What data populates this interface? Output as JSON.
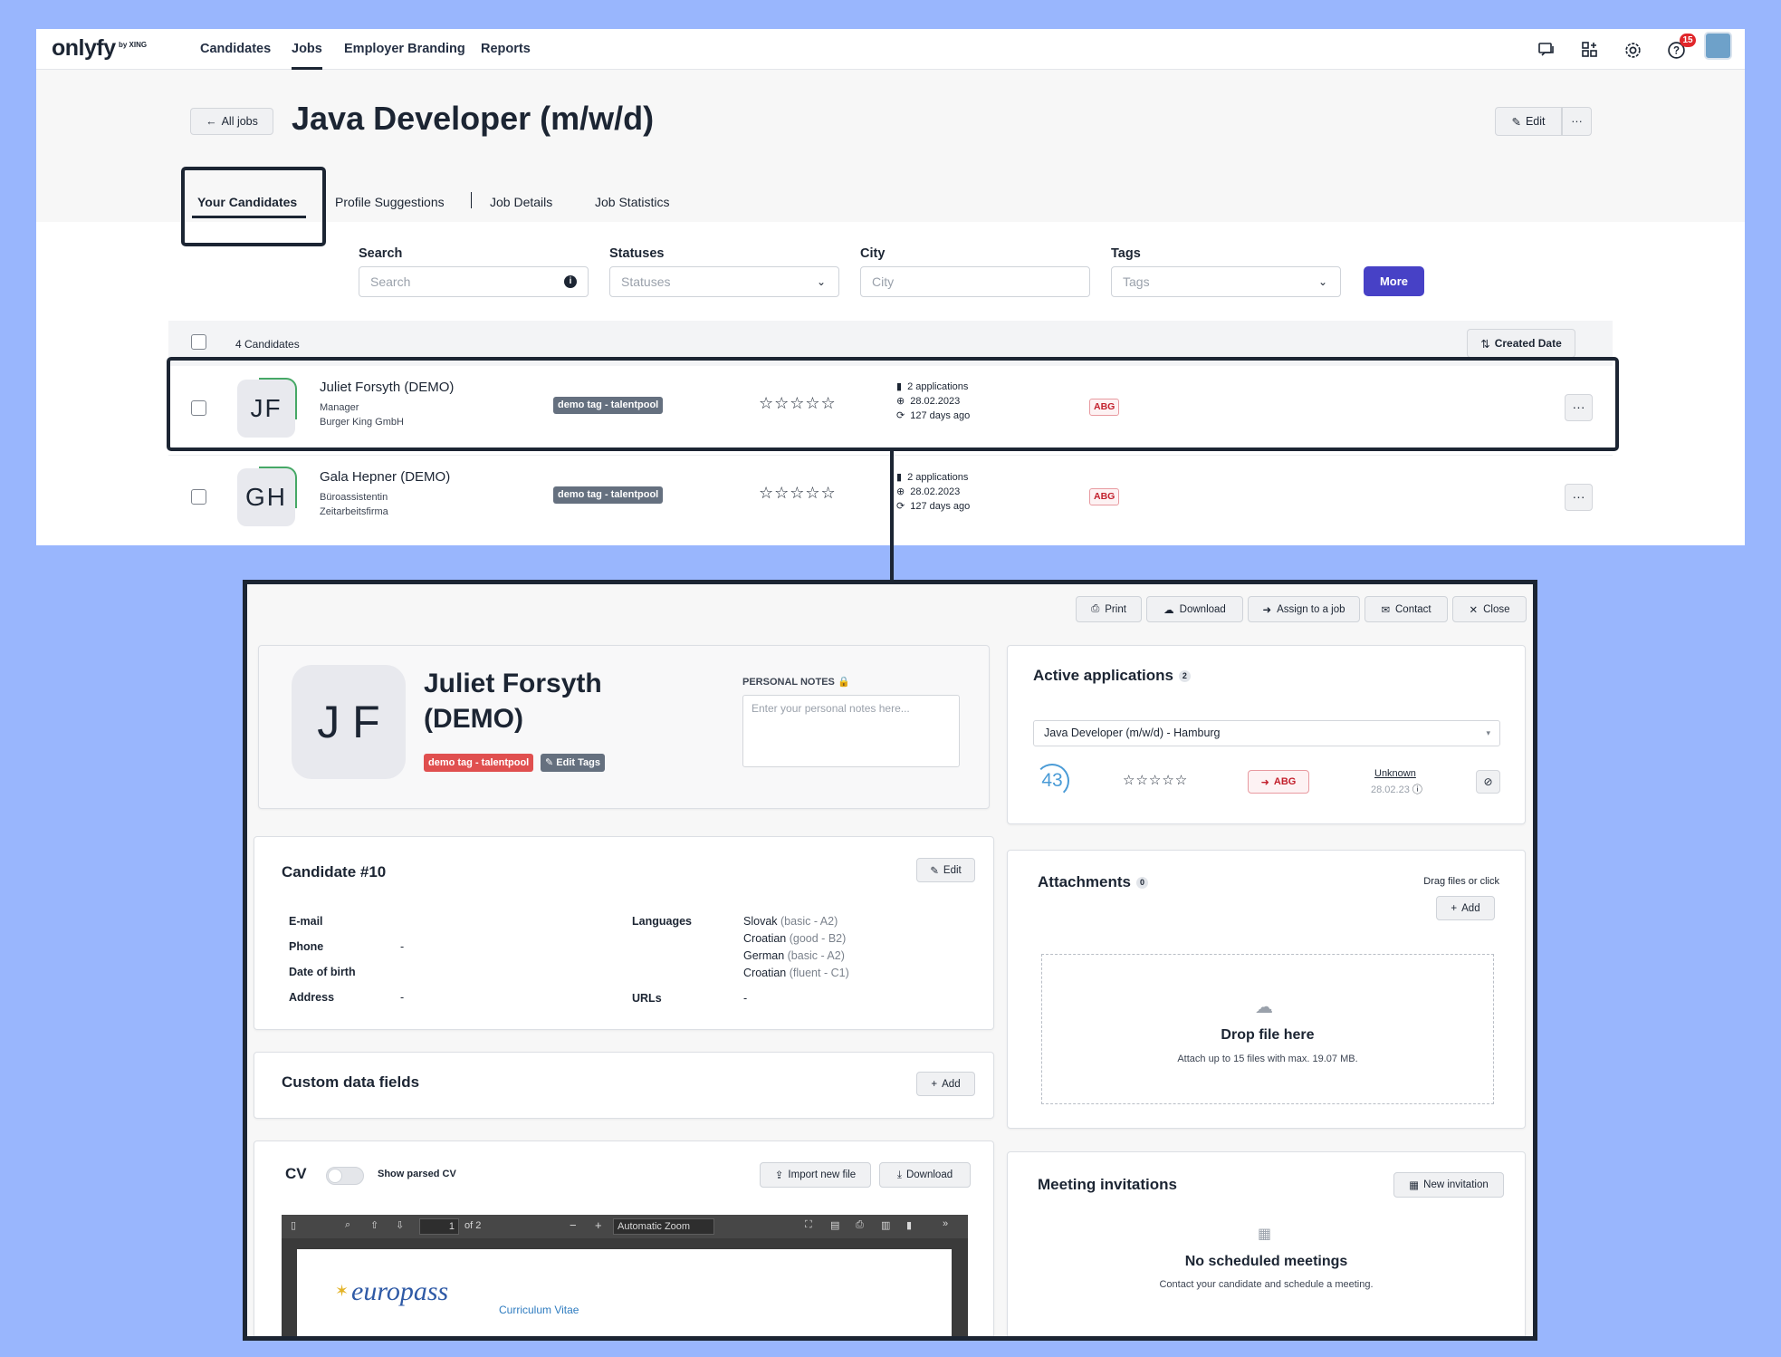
{
  "app": {
    "logo": "onlyfy",
    "logo_sub": "by XING",
    "nav": [
      "Candidates",
      "Jobs",
      "Employer Branding",
      "Reports"
    ],
    "notification_count": "15"
  },
  "job": {
    "back_label": "All jobs",
    "title": "Java Developer (m/w/d)",
    "edit_label": "Edit",
    "more_label": "···",
    "tabs": [
      "Your Candidates",
      "Profile Suggestions",
      "Job Details",
      "Job Statistics"
    ]
  },
  "filters": {
    "search_label": "Search",
    "search_placeholder": "Search",
    "statuses_label": "Statuses",
    "statuses_placeholder": "Statuses",
    "city_label": "City",
    "city_placeholder": "City",
    "tags_label": "Tags",
    "tags_placeholder": "Tags",
    "more_label": "More"
  },
  "list": {
    "count_label": "4 Candidates",
    "sort_label": "Created Date",
    "rows": [
      {
        "initials": "JF",
        "name": "Juliet Forsyth (DEMO)",
        "position": "Manager",
        "company": "Burger King GmbH",
        "tag": "demo tag - talentpool",
        "stars": "☆☆☆☆☆",
        "applications": "2 applications",
        "date": "28.02.2023",
        "age": "127 days ago",
        "status": "ABG",
        "menu": "···"
      },
      {
        "initials": "GH",
        "name": "Gala Hepner (DEMO)",
        "position": "Büroassistentin",
        "company": "Zeitarbeitsfirma",
        "tag": "demo tag - talentpool",
        "stars": "☆☆☆☆☆",
        "applications": "2 applications",
        "date": "28.02.2023",
        "age": "127 days ago",
        "status": "ABG",
        "menu": "···"
      }
    ]
  },
  "panel": {
    "actions": [
      "Print",
      "Download",
      "Assign to a job",
      "Contact",
      "Close"
    ],
    "profile": {
      "initials": "J F",
      "name_line1": "Juliet Forsyth",
      "name_line2": "(DEMO)",
      "tag": "demo tag - talentpool",
      "edit_tags": "Edit Tags",
      "notes_label": "PERSONAL NOTES",
      "notes_placeholder": "Enter your personal notes here..."
    },
    "applications": {
      "title": "Active applications",
      "count": "2",
      "selected_job": "Java Developer (m/w/d) - Hamburg",
      "score": "43",
      "stars": "☆☆☆☆☆",
      "status": "ABG",
      "source": "Unknown",
      "source_date": "28.02.23"
    },
    "candidate": {
      "title": "Candidate #10",
      "edit_label": "Edit",
      "fields": [
        {
          "label": "E-mail",
          "value": ""
        },
        {
          "label": "Phone",
          "value": "-"
        },
        {
          "label": "Date of birth",
          "value": ""
        },
        {
          "label": "Address",
          "value": "-"
        }
      ],
      "languages_label": "Languages",
      "languages": [
        {
          "name": "Slovak",
          "level": "(basic - A2)"
        },
        {
          "name": "Croatian",
          "level": "(good - B2)"
        },
        {
          "name": "German",
          "level": "(basic - A2)"
        },
        {
          "name": "Croatian",
          "level": "(fluent - C1)"
        }
      ],
      "urls_label": "URLs",
      "urls_value": "-"
    },
    "custom": {
      "title": "Custom data fields",
      "add_label": "Add"
    },
    "cv": {
      "title": "CV",
      "toggle_label": "Show parsed CV",
      "import_label": "Import new file",
      "download_label": "Download",
      "page_value": "1",
      "page_of": "of 2",
      "zoom_label": "Automatic Zoom",
      "doc_brand": "europass",
      "doc_title": "Curriculum Vitae"
    },
    "attachments": {
      "title": "Attachments",
      "count": "0",
      "hint": "Drag files or click",
      "add_label": "Add",
      "drop_title": "Drop file here",
      "drop_sub": "Attach up to 15 files with max. 19.07 MB."
    },
    "meetings": {
      "title": "Meeting invitations",
      "new_label": "New invitation",
      "empty_title": "No scheduled meetings",
      "empty_sub": "Contact your candidate and schedule a meeting."
    }
  },
  "colors": {
    "background": "#99b6fd",
    "primary": "#4741c6",
    "dark": "#1c2533",
    "tag_red": "#e04f4f",
    "status_red": "#c21f2b",
    "success_green": "#46a866"
  }
}
